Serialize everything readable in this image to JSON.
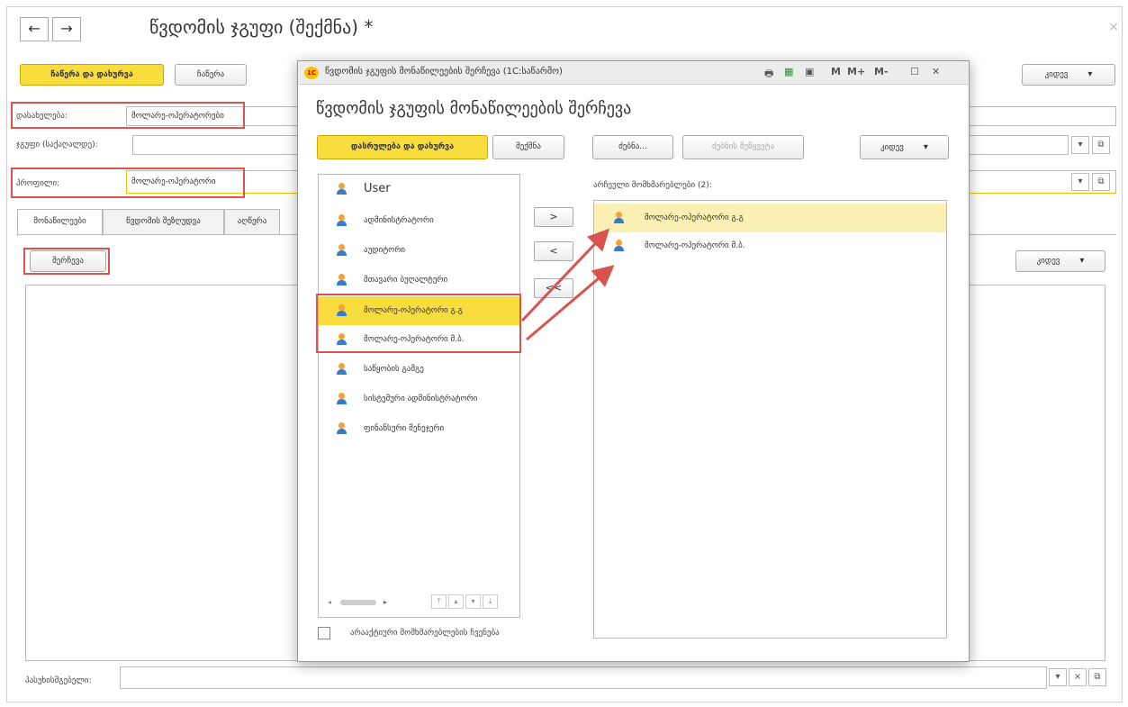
{
  "window": {
    "title": "წვდომის ჯგუფი (შექმნა) *",
    "back_icon": "arrow-left-icon",
    "forward_icon": "arrow-right-icon",
    "close_icon": "close-icon"
  },
  "toolbar": {
    "save_close": "ჩაწერა და დახურვა",
    "save": "ჩაწერა",
    "more": "კიდევ"
  },
  "form": {
    "name_label": "დასახელება:",
    "name_value": "მოლარე-ოპერატორები",
    "group_label": "ჯგუფი (საქაღალდე):",
    "group_value": "",
    "profile_label": "პროფილი:",
    "profile_value": "მოლარე-ოპერატორი",
    "responsible_label": "პასუხისმგებელი:",
    "responsible_value": ""
  },
  "tabs": [
    {
      "label": "მონაწილეები"
    },
    {
      "label": "წვდომის შეზღუდვა"
    },
    {
      "label": "აღწერა"
    }
  ],
  "members": {
    "pick_button": "შერჩევა",
    "more": "კიდევ"
  },
  "dialog": {
    "title": "წვდომის ჯგუფის მონაწილეების შერჩევა  (1C:საწარმო)",
    "heading": "წვდომის ჯგუფის მონაწილეების შერჩევა",
    "toolbar_icons": [
      "print-icon",
      "table-icon",
      "calendar-icon"
    ],
    "mem_buttons": [
      "M",
      "M+",
      "M-"
    ],
    "buttons": {
      "finish_close": "დასრულება და დახურვა",
      "create": "შექმნა",
      "find": "ძებნა...",
      "cancel_find": "ძებნის შეწყვეტა",
      "more": "კიდევ"
    },
    "left_list": [
      "User",
      "ადმინისტრატორი",
      "აუდიტორი",
      "მთავარი  ბუღალტერი",
      "მოლარე-ოპერატორი გ.გ",
      "მოლარე-ოპერატორი მ.ბ.",
      "საწყობის გამგე",
      "სისტემური ადმინისტრატორი",
      "ფინანსური მენეჯერი"
    ],
    "selected_header": "არჩეული მომხმარებლები (2):",
    "right_list": [
      "მოლარე-ოპერატორი გ.გ",
      "მოლარე-ოპერატორი მ.ბ."
    ],
    "move_buttons": [
      ">",
      "<",
      "<<"
    ],
    "show_inactive": "არააქტიური მომხმარებლების ჩვენება"
  }
}
